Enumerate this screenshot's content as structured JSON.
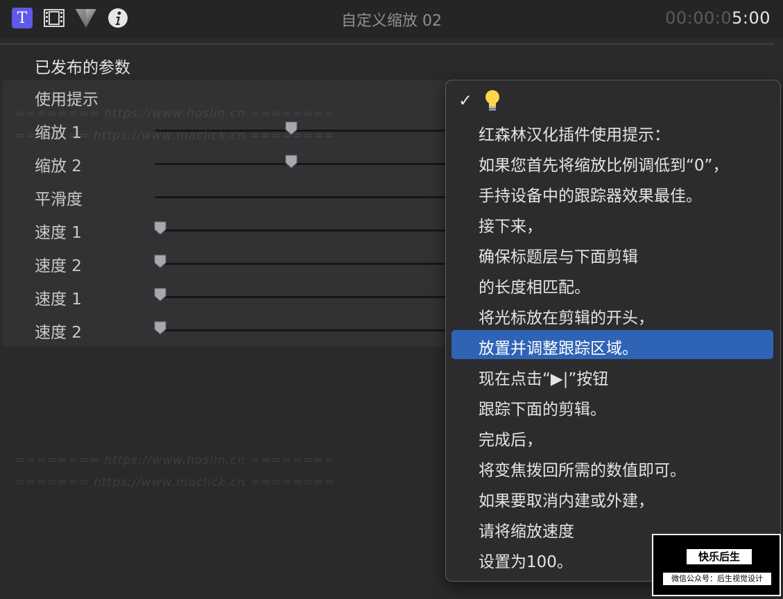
{
  "header": {
    "tools": [
      {
        "name": "text-inspector",
        "icon": "text-icon",
        "glyph": "T",
        "active": true
      },
      {
        "name": "video-inspector",
        "icon": "film-icon"
      },
      {
        "name": "color-inspector",
        "icon": "color-triangle-icon"
      },
      {
        "name": "info-inspector",
        "icon": "info-icon"
      }
    ],
    "title": "自定义缩放 02",
    "timecode_dim": "00:00:0",
    "timecode_lit": "5:00"
  },
  "section": {
    "title": "已发布的参数"
  },
  "params": [
    {
      "label": "使用提示",
      "type": "popup"
    },
    {
      "label": "缩放 1",
      "type": "slider",
      "value": 0.65
    },
    {
      "label": "缩放 2",
      "type": "slider",
      "value": 0.65
    },
    {
      "label": "平滑度",
      "type": "slider",
      "value": null
    },
    {
      "label": "速度 1",
      "type": "slider",
      "value": 0.0
    },
    {
      "label": "速度 2",
      "type": "slider",
      "value": 0.0
    },
    {
      "label": "速度 1",
      "type": "slider",
      "value": 0.0
    },
    {
      "label": "速度 2",
      "type": "slider",
      "value": 0.0
    }
  ],
  "popup_menu": {
    "checked_icon": "lightbulb-icon",
    "selected_index": 8,
    "items": [
      "红森林汉化插件使用提示：",
      "如果您首先将缩放比例调低到“0”，",
      "手持设备中的跟踪器效果最佳。",
      "接下来，",
      "确保标题层与下面剪辑",
      "的长度相匹配。",
      "将光标放在剪辑的开头，",
      "放置并调整跟踪区域。",
      "现在点击“▶|”按钮",
      "跟踪下面的剪辑。",
      "完成后，",
      "将变焦拨回所需的数值即可。",
      "如果要取消内建或外建，",
      "请将缩放速度",
      "设置为100。"
    ]
  },
  "watermarks": [
    "======== https://www.hoslin.cn ========",
    "======= https://www.maclick.cn ========"
  ],
  "badge": {
    "top": "快乐后生",
    "bottom": "微信公众号：后生视觉设计"
  },
  "colors": {
    "accent": "#5f58e8",
    "selection": "#2f63b5"
  }
}
